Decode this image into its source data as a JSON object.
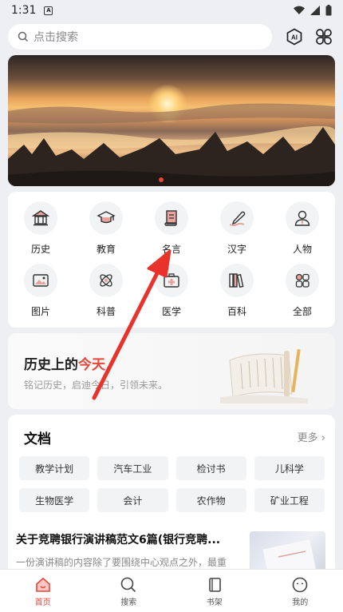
{
  "status_bar": {
    "time": "1:31",
    "notification_badge": "A"
  },
  "search": {
    "placeholder": "点击搜索",
    "ai_label": "AI"
  },
  "categories": [
    {
      "label": "历史",
      "icon": "history-building-icon"
    },
    {
      "label": "教育",
      "icon": "graduation-cap-icon"
    },
    {
      "label": "名言",
      "icon": "scroll-icon"
    },
    {
      "label": "汉字",
      "icon": "pen-icon"
    },
    {
      "label": "人物",
      "icon": "person-icon"
    },
    {
      "label": "图片",
      "icon": "image-icon"
    },
    {
      "label": "科普",
      "icon": "atom-icon"
    },
    {
      "label": "医学",
      "icon": "medical-kit-icon"
    },
    {
      "label": "百科",
      "icon": "books-icon"
    },
    {
      "label": "全部",
      "icon": "grid-icon"
    }
  ],
  "history_today": {
    "title_prefix": "历史上的",
    "title_highlight": "今天",
    "subtitle": "铭记历史，启迪今日，引领未来。"
  },
  "documents": {
    "title": "文档",
    "more": "更多",
    "tags": [
      "教学计划",
      "汽车工业",
      "检讨书",
      "儿科学",
      "生物医学",
      "会计",
      "农作物",
      "矿业工程"
    ],
    "article": {
      "title": "关于竞聘银行演讲稿范文6篇(银行竞聘...",
      "excerpt": "一份演讲稿的内容除了要围绕中心观点之外，最重"
    }
  },
  "tabs": [
    {
      "label": "首页",
      "icon": "home-icon",
      "active": true
    },
    {
      "label": "搜索",
      "icon": "search-icon",
      "active": false
    },
    {
      "label": "书架",
      "icon": "bookshelf-icon",
      "active": false
    },
    {
      "label": "我的",
      "icon": "profile-icon",
      "active": false
    }
  ],
  "colors": {
    "accent": "#e6463c",
    "background": "#eeeff3"
  }
}
